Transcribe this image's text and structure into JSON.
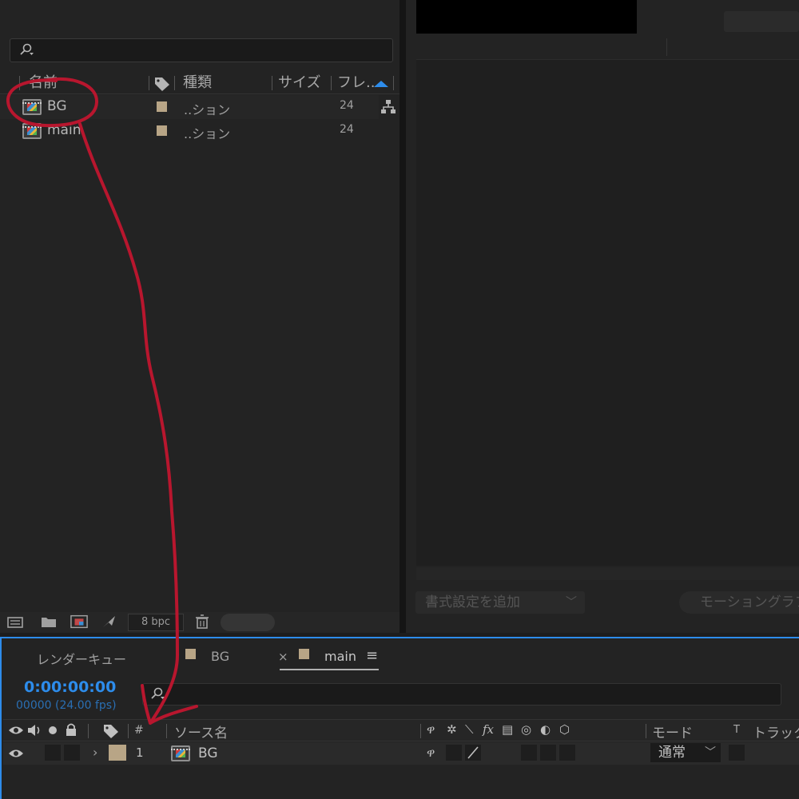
{
  "project": {
    "columns": {
      "name": "名前",
      "type": "種類",
      "size": "サイズ",
      "frame": "フレ..."
    },
    "items": [
      {
        "name": "BG",
        "type": "..ション",
        "fps": "24"
      },
      {
        "name": "main",
        "type": "..ション",
        "fps": "24"
      }
    ],
    "bpc": "8 bpc"
  },
  "right_panel": {
    "format_dropdown": "書式設定を追加",
    "motion_button": "モーショングラフィ"
  },
  "timeline": {
    "tabs": {
      "render_queue": "レンダーキュー",
      "bg": "BG",
      "main": "main"
    },
    "timecode": "0:00:00:00",
    "fps_readout": "00000 (24.00 fps)",
    "columns": {
      "number": "#",
      "source_name": "ソース名",
      "mode": "モード",
      "t": "T",
      "track_matte": "トラックマ"
    },
    "layer": {
      "number": "1",
      "name": "BG",
      "mode": "通常"
    }
  },
  "colors": {
    "accent": "#2d8ceb",
    "annotation": "#b8162e",
    "label_swatch": "#b8a586"
  }
}
